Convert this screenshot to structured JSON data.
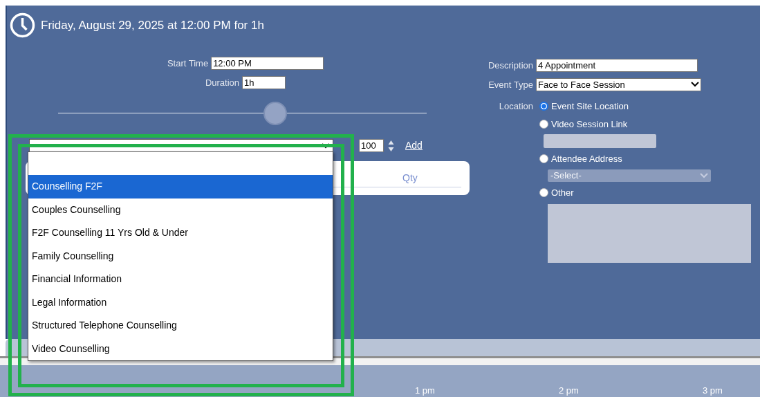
{
  "header": {
    "title": "Friday, August 29, 2025 at 12:00 PM for 1h"
  },
  "time": {
    "start_label": "Start Time",
    "start_value": "12:00 PM",
    "duration_label": "Duration",
    "duration_value": "1h",
    "slider": {
      "level": 0.59
    }
  },
  "service": {
    "qty_value": "100",
    "add_label": "Add",
    "qty_header": "Qty",
    "options": [
      {
        "kind": "blank",
        "selected": false
      },
      {
        "kind": "text",
        "label": "Counselling F2F",
        "selected": true
      },
      {
        "kind": "text",
        "label": "Couples Counselling",
        "selected": false
      },
      {
        "kind": "text",
        "label": "F2F Counselling 11 Yrs Old & Under",
        "selected": false
      },
      {
        "kind": "text",
        "label": "Family Counselling",
        "selected": false
      },
      {
        "kind": "text",
        "label": "Financial Information",
        "selected": false
      },
      {
        "kind": "text",
        "label": "Legal Information",
        "selected": false
      },
      {
        "kind": "text",
        "label": "Structured Telephone Counselling",
        "selected": false
      },
      {
        "kind": "text",
        "label": "Video Counselling",
        "selected": false
      }
    ]
  },
  "details": {
    "description_label": "Description",
    "description_value": "4 Appointment",
    "event_type_label": "Event Type",
    "event_type_value": "Face to Face Session",
    "location_label": "Location",
    "locations": [
      {
        "kind": "plain",
        "label": "Event Site Location",
        "selected": true
      },
      {
        "kind": "link-field",
        "label": "Video Session Link",
        "selected": false,
        "disabled": true
      },
      {
        "kind": "address-select",
        "label": "Attendee Address",
        "selected": false,
        "disabled": true,
        "value": "-Select-"
      },
      {
        "kind": "textarea",
        "label": "Other",
        "selected": false,
        "disabled": true
      }
    ]
  },
  "timeline": {
    "ticks": [
      "1 pm",
      "2 pm",
      "3 pm"
    ]
  }
}
